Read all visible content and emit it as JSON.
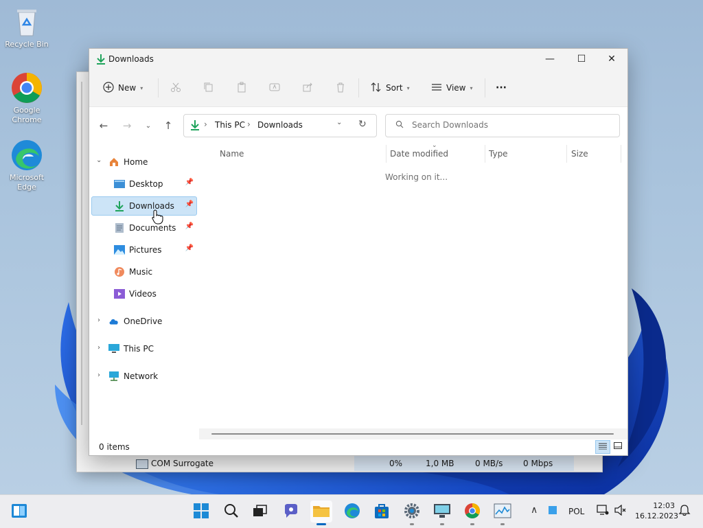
{
  "desktop": {
    "icons": [
      {
        "label": "Recycle Bin",
        "icon": "recycle-bin-icon"
      },
      {
        "label": "Google Chrome",
        "icon": "chrome-icon"
      },
      {
        "label": "Microsoft Edge",
        "icon": "edge-icon"
      }
    ]
  },
  "background_window": {
    "row": {
      "name": "COM Surrogate",
      "cpu": "0%",
      "memory": "1,0 MB",
      "disk": "0 MB/s",
      "network": "0 Mbps"
    }
  },
  "explorer": {
    "title": "Downloads",
    "window_buttons": {
      "minimize": "—",
      "maximize": "☐",
      "close": "✕"
    },
    "command_bar": {
      "new_label": "New",
      "sort_label": "Sort",
      "view_label": "View",
      "more_label": "···"
    },
    "address": {
      "root": "This PC",
      "current": "Downloads",
      "separator": "›"
    },
    "search": {
      "placeholder": "Search Downloads"
    },
    "sidebar": {
      "home": "Home",
      "quick_access": [
        {
          "label": "Desktop",
          "pinned": true
        },
        {
          "label": "Downloads",
          "pinned": true,
          "selected": true
        },
        {
          "label": "Documents",
          "pinned": true
        },
        {
          "label": "Pictures",
          "pinned": true
        },
        {
          "label": "Music",
          "pinned": false
        },
        {
          "label": "Videos",
          "pinned": false
        }
      ],
      "onedrive": "OneDrive",
      "this_pc": "This PC",
      "network": "Network"
    },
    "columns": [
      "Name",
      "Date modified",
      "Type",
      "Size"
    ],
    "status_message": "Working on it...",
    "status_bar": {
      "items_count": "0 items"
    }
  },
  "taskbar": {
    "tray": {
      "language": "POL",
      "time": "12:03",
      "date": "16.12.2023"
    },
    "colors": {
      "accent": "#0067c0",
      "folder": "#f5c342"
    }
  }
}
